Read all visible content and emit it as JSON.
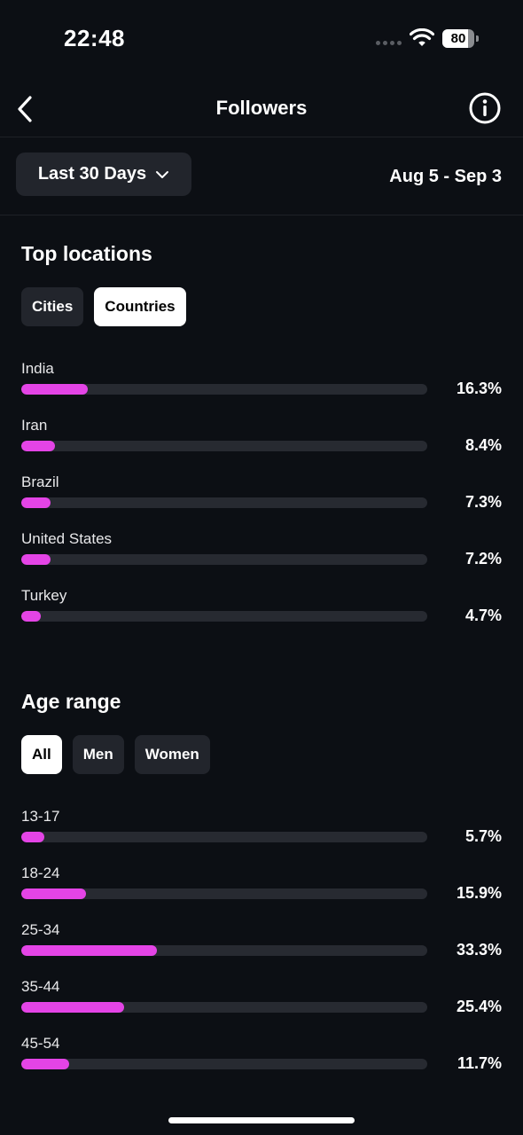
{
  "status_bar": {
    "time": "22:48",
    "battery": "80",
    "battery_level": 0.8
  },
  "header": {
    "title": "Followers"
  },
  "filter": {
    "period_label": "Last 30 Days",
    "date_range": "Aug 5 - Sep 3"
  },
  "accent_color": "#e444e6",
  "top_locations": {
    "title": "Top locations",
    "tabs": [
      {
        "label": "Cities",
        "selected": false
      },
      {
        "label": "Countries",
        "selected": true
      }
    ],
    "items": [
      {
        "label": "India",
        "value": 16.3,
        "pct_label": "16.3%"
      },
      {
        "label": "Iran",
        "value": 8.4,
        "pct_label": "8.4%"
      },
      {
        "label": "Brazil",
        "value": 7.3,
        "pct_label": "7.3%"
      },
      {
        "label": "United States",
        "value": 7.2,
        "pct_label": "7.2%"
      },
      {
        "label": "Turkey",
        "value": 4.7,
        "pct_label": "4.7%"
      }
    ]
  },
  "age_range": {
    "title": "Age range",
    "tabs": [
      {
        "label": "All",
        "selected": true
      },
      {
        "label": "Men",
        "selected": false
      },
      {
        "label": "Women",
        "selected": false
      }
    ],
    "items": [
      {
        "label": "13-17",
        "value": 5.7,
        "pct_label": "5.7%"
      },
      {
        "label": "18-24",
        "value": 15.9,
        "pct_label": "15.9%"
      },
      {
        "label": "25-34",
        "value": 33.3,
        "pct_label": "33.3%"
      },
      {
        "label": "35-44",
        "value": 25.4,
        "pct_label": "25.4%"
      },
      {
        "label": "45-54",
        "value": 11.7,
        "pct_label": "11.7%"
      }
    ]
  }
}
